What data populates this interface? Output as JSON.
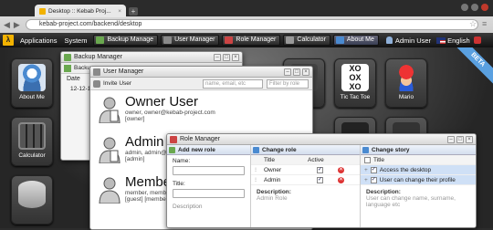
{
  "browser": {
    "tab_title": "Desktop :: Kebab Proj...",
    "new_tab": "+",
    "url": "kebab-project.com/backend/desktop"
  },
  "taskbar": {
    "menus": [
      "Applications",
      "System"
    ],
    "buttons": [
      {
        "label": "Backup Manage",
        "icon": "backup-icon",
        "color": "#6aa84f"
      },
      {
        "label": "User Manager",
        "icon": "user-icon",
        "color": "#8a8a8a"
      },
      {
        "label": "Role Manager",
        "icon": "role-icon",
        "color": "#c44"
      },
      {
        "label": "Calculator",
        "icon": "calculator-icon",
        "color": "#999"
      },
      {
        "label": "About Me",
        "icon": "person-icon",
        "color": "#4a8ad0"
      }
    ],
    "admin_user": "Admin User",
    "language": "English"
  },
  "desktop": {
    "icons": [
      {
        "label": "About Me"
      },
      {
        "label": "Calculator"
      },
      {
        "label": "Tic Tac Toe"
      },
      {
        "label": "Mario"
      }
    ],
    "beta_ribbon": "BETA"
  },
  "backup_manager": {
    "title": "Backup Manager",
    "toolbar": "Backup",
    "col_date": "Date",
    "row_date": "12-12-1"
  },
  "user_manager": {
    "title": "User Manager",
    "invite_user": "Invite User",
    "search_placeholder": "name, email, etc",
    "filter_placeholder": "Filter by role",
    "users": [
      {
        "name": "Owner User",
        "email": "owner, owner@kebab-project.com",
        "role": "[owner]"
      },
      {
        "name": "Admin U",
        "email": "admin, admin@k",
        "role": "[admin]"
      },
      {
        "name": "Member",
        "email": "member, memb",
        "role": "[guest] [member"
      }
    ]
  },
  "role_manager": {
    "title": "Role Manager",
    "add_new_role": {
      "title": "Add new role",
      "name_label": "Name:",
      "title_label": "Title:",
      "description_label": "Description"
    },
    "change_role": {
      "title": "Change role",
      "col_title": "Title",
      "col_active": "Active",
      "rows": [
        {
          "title": "Owner",
          "active": true
        },
        {
          "title": "Admin",
          "active": true
        }
      ],
      "description_label": "Description:",
      "description_value": "Admin Role"
    },
    "change_story": {
      "title": "Change story",
      "col_title": "Title",
      "rows": [
        {
          "title": "Access the desktop",
          "checked": true
        },
        {
          "title": "User can change their profile",
          "checked": true
        }
      ],
      "description_label": "Description:",
      "description_value": "User can change name, surname, language etc"
    }
  }
}
